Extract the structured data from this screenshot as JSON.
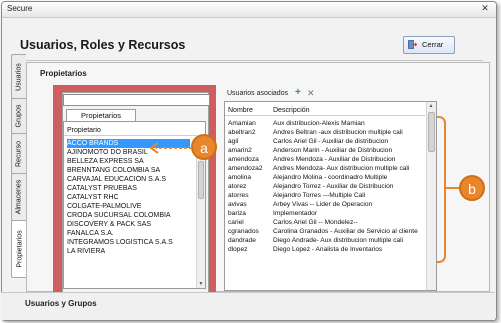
{
  "window": {
    "title": "Secure"
  },
  "header": {
    "title": "Usuarios, Roles y Recursos",
    "close_button": "Cerrar"
  },
  "vtabs": [
    "Usuarios",
    "Grupos",
    "Recurso",
    "Almacenes",
    "Propietarios"
  ],
  "section": {
    "title": "Propietarios"
  },
  "propietarios": {
    "search_value": "",
    "tab_label": "Propietarios",
    "column_header": "Propietario",
    "items": [
      "ACCO BRANDS",
      "AJINOMOTO DO BRASIL",
      "BELLEZA EXPRESS SA",
      "BRENNTANG COLOMBIA SA",
      "CARVAJAL EDUCACIÓN S.A.S",
      "CATALYST PRUEBAS",
      "CATALYST RHC",
      "COLGATE-PALMOLIVE",
      "CRODA SUCURSAL COLOMBIA",
      "DISCOVERY & PACK SAS",
      "FANALCA S.A.",
      "INTEGRAMOS LOGISTICA S.A.S",
      "LA RIVIERA"
    ],
    "selected_index": 0
  },
  "usuarios": {
    "title": "Usuarios asociados",
    "columns": [
      "Nombre",
      "Descripción"
    ],
    "rows": [
      [
        "Amamian",
        "Aux distribucion-Alexis Mamian"
      ],
      [
        "abeltran2",
        "Andres Beltran -aux distribucion multiple cali"
      ],
      [
        "agil",
        "Carlos Ariel Gil - Auxiliar de distribucion"
      ],
      [
        "amarin2",
        "Anderson Marin - Auxiliar de Distribucion"
      ],
      [
        "amendoza",
        "Andres Mendoza - Auxiliar de Distribucion"
      ],
      [
        "amendoza2",
        "Andres Mendoza- Aux distribucion multiple cali"
      ],
      [
        "amolina",
        "Alejandro Molina - coordinadro Multiple"
      ],
      [
        "atorez",
        "Alejandro Torrez - Auxiliar de Distribucion"
      ],
      [
        "atorres",
        "Alejandro Torres ---Multiple Cali"
      ],
      [
        "avivas",
        "Arbey Vivas -- Lider de Operacion"
      ],
      [
        "bariza",
        "Implementador"
      ],
      [
        "cariel",
        "Carlos Ariel Gil -- Mondelez--"
      ],
      [
        "cgranados",
        "Carolina Granados - Auxiliar de Servicio al cliente"
      ],
      [
        "dandrade",
        "Diego Andrade- Aux distribucion multiple cali"
      ],
      [
        "dlopez",
        "Diego Lopez - Analista de Inventarios"
      ]
    ]
  },
  "callouts": [
    "a",
    "b"
  ],
  "footer": {
    "label": "Usuarios y Grupos"
  },
  "colors": {
    "highlight": "#cf5e60",
    "accent": "#e8862e",
    "selection": "#3399ff"
  }
}
